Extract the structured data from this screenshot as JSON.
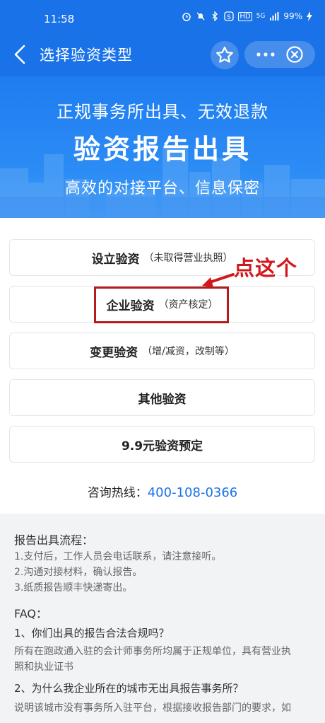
{
  "status_bar": {
    "time": "11:58",
    "battery": "99%",
    "network": "5G",
    "hd": "HD"
  },
  "nav": {
    "title": "选择验资类型",
    "back_icon": "back-arrow-icon",
    "star_icon": "star-icon",
    "more_icon": "more-icon",
    "close_icon": "close-circle-icon"
  },
  "banner": {
    "line1": "正规事务所出具、无效退款",
    "line2": "验资报告出具",
    "line3": "高效的对接平台、信息保密"
  },
  "options": [
    {
      "main": "设立验资",
      "sub": "（未取得营业执照）"
    },
    {
      "main": "企业验资",
      "sub": "（资产核定）"
    },
    {
      "main": "变更验资",
      "sub": "（增/减资，改制等）"
    },
    {
      "main": "其他验资",
      "sub": ""
    },
    {
      "main": "9.9元验资预定",
      "sub": ""
    }
  ],
  "annotation": {
    "text": "点这个",
    "color": "#d1171c"
  },
  "hotline": {
    "label": "咨询热线：",
    "number": "400-108-0366"
  },
  "info": {
    "process_title": "报告出具流程：",
    "steps": [
      "1.支付后，工作人员会电话联系，请注意接听。",
      "2.沟通对接材料，确认报告。",
      "3.纸质报告顺丰快递寄出。"
    ],
    "faq_title": "FAQ：",
    "q1": "1、你们出具的报告合法合规吗？",
    "a1_line1": "所有在跑政通入驻的会计师事务所均属于正规单位，具有营业执",
    "a1_line2": "照和执业证书",
    "q2": "2、为什么我企业所在的城市无出具报告事务所？",
    "a2_line1": "说明该城市没有事务所入驻平台，根据接收报告部门的要求，如"
  },
  "colors": {
    "brand": "#1a72e8",
    "highlight_box": "#b51c1c"
  }
}
